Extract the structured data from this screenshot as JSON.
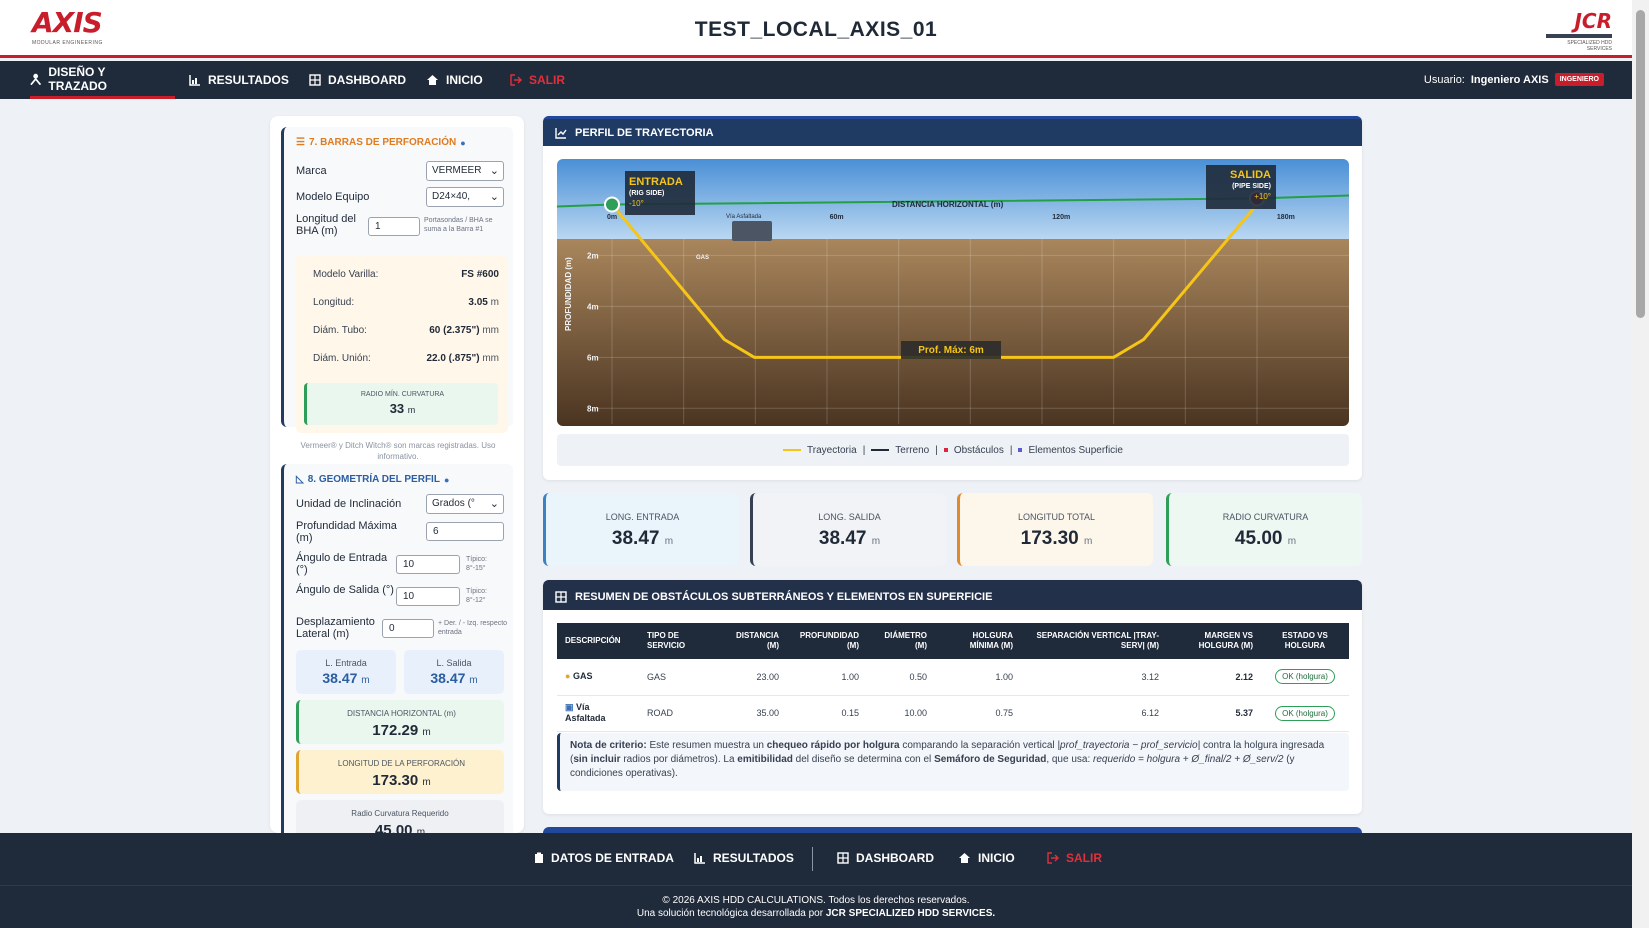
{
  "header": {
    "title": "TEST_LOCAL_AXIS_01",
    "logo_left": "AXIS",
    "logo_left_sub": "MODULAR ENGINEERING",
    "logo_right": "JCR",
    "logo_right_sub": "SPECIALIZED HDD SERVICES"
  },
  "nav": {
    "items": [
      {
        "label": "DISEÑO Y TRAZADO",
        "icon": "user-compass-icon"
      },
      {
        "label": "RESULTADOS",
        "icon": "chart-icon"
      },
      {
        "label": "DASHBOARD",
        "icon": "grid-icon"
      },
      {
        "label": "INICIO",
        "icon": "home-icon"
      },
      {
        "label": "SALIR",
        "icon": "logout-icon"
      }
    ],
    "user_label": "Usuario:",
    "user_name": "Ingeniero AXIS",
    "user_role": "INGENIERO"
  },
  "barras": {
    "title": "7. BARRAS DE PERFORACIÓN",
    "marca_label": "Marca",
    "marca_value": "VERMEER",
    "modelo_label": "Modelo Equipo",
    "modelo_value": "D24×40,",
    "bha_label": "Longitud del BHA (m)",
    "bha_value": "1",
    "bha_hint": "Portasondas / BHA se suma a la Barra #1",
    "varilla_label": "Modelo Varilla:",
    "varilla_value": "FS #600",
    "longitud_label": "Longitud:",
    "longitud_value": "3.05",
    "longitud_unit": "m",
    "tubo_label": "Diám. Tubo:",
    "tubo_value": "60 (2.375\")",
    "tubo_unit": "mm",
    "union_label": "Diám. Unión:",
    "union_value": "22.0 (.875\")",
    "union_unit": "mm",
    "radio_label": "RADIO MÍN. CURVATURA",
    "radio_value": "33",
    "radio_unit": "m",
    "disclaimer": "Vermeer® y Ditch Witch® son marcas registradas. Uso informativo."
  },
  "geometria": {
    "title": "8. GEOMETRÍA DEL PERFIL",
    "unidad_label": "Unidad de Inclinación",
    "unidad_value": "Grados (°",
    "prof_label": "Profundidad Máxima (m)",
    "prof_value": "6",
    "ang_entrada_label": "Ángulo de Entrada (°)",
    "ang_entrada_value": "10",
    "ang_entrada_hint": "Típico: 8°-15°",
    "ang_salida_label": "Ángulo de Salida (°)",
    "ang_salida_value": "10",
    "ang_salida_hint": "Típico: 8°-12°",
    "desp_label": "Desplazamiento Lateral (m)",
    "desp_value": "0",
    "desp_hint": "+ Der. / - Izq. respecto entrada",
    "l_entrada_label": "L. Entrada",
    "l_entrada_value": "38.47",
    "l_salida_label": "L. Salida",
    "l_salida_value": "38.47",
    "unit_m": "m",
    "dist_h_label": "DISTANCIA HORIZONTAL (m)",
    "dist_h_value": "172.29",
    "long_perf_label": "LONGITUD DE LA PERFORACIÓN",
    "long_perf_value": "173.30",
    "radio_req_label": "Radio Curvatura Requerido",
    "radio_req_value": "45.00"
  },
  "perfil": {
    "title": "PERFIL DE TRAYECTORIA",
    "entrada_title": "ENTRADA",
    "entrada_sub": "(RIG SIDE)",
    "entrada_angle": "-10°",
    "salida_title": "SALIDA",
    "salida_sub": "(PIPE SIDE)",
    "salida_angle": "+10°",
    "x_axis_title": "DISTANCIA HORIZONTAL (m)",
    "y_axis_title": "PROFUNDIDAD (m)",
    "prof_max_label": "Prof. Máx: 6m",
    "obstacle_gas": "GAS",
    "surface_via": "Vía Asfaltada",
    "legend": {
      "trayectoria": "Trayectoria",
      "terreno": "Terreno",
      "obstaculos": "Obstáculos",
      "elementos": "Elementos Superficie"
    }
  },
  "chart_data": {
    "type": "line",
    "title": "PERFIL DE TRAYECTORIA",
    "xlabel": "DISTANCIA HORIZONTAL (m)",
    "ylabel": "PROFUNDIDAD (m)",
    "x_ticks": [
      "0m",
      "60m",
      "120m",
      "180m"
    ],
    "y_ticks": [
      "2m",
      "4m",
      "6m",
      "8m"
    ],
    "xlim": [
      0,
      172.29
    ],
    "ylim": [
      8.5,
      -1
    ],
    "series": [
      {
        "name": "Trayectoria",
        "color": "#f5c518",
        "x": [
          0,
          30,
          38,
          134,
          142,
          172.29
        ],
        "y": [
          0,
          5.3,
          6,
          6,
          5.3,
          0
        ]
      },
      {
        "name": "Terreno",
        "color": "#22a045",
        "x": [
          0,
          172.29
        ],
        "y": [
          0,
          0
        ]
      }
    ],
    "points": [
      {
        "name": "Entrada",
        "x": 0,
        "y": 0,
        "color": "#2f9e58"
      },
      {
        "name": "Salida",
        "x": 172.29,
        "y": 0,
        "color": "#d7263d"
      }
    ],
    "obstacles": [
      {
        "name": "GAS",
        "x": 23,
        "y": 1
      }
    ],
    "surface_elements": [
      {
        "name": "Vía Asfaltada",
        "x": 35,
        "y": 0.15
      }
    ],
    "grid": true,
    "legend": "bottom"
  },
  "kpis": [
    {
      "label": "LONG. ENTRADA",
      "value": "38.47",
      "unit": "m",
      "accent": "#3b82c4",
      "bg": "#eaf4fb"
    },
    {
      "label": "LONG. SALIDA",
      "value": "38.47",
      "unit": "m",
      "accent": "#374151",
      "bg": "#f1f3f6"
    },
    {
      "label": "LONGITUD TOTAL",
      "value": "173.30",
      "unit": "m",
      "accent": "#e08a2e",
      "bg": "#fdf6ea"
    },
    {
      "label": "RADIO CURVATURA",
      "value": "45.00",
      "unit": "m",
      "accent": "#2f9e58",
      "bg": "#ecf8f1"
    }
  ],
  "obstaculos": {
    "title": "RESUMEN DE OBSTÁCULOS SUBTERRÁNEOS Y ELEMENTOS EN SUPERFICIE",
    "headers": [
      "DESCRIPCIÓN",
      "TIPO DE SERVICIO",
      "DISTANCIA (M)",
      "PROFUNDIDAD (M)",
      "DIÁMETRO (M)",
      "HOLGURA MÍNIMA (M)",
      "SEPARACIÓN VERTICAL |TRAY-SERV| (M)",
      "MARGEN VS HOLGURA (M)",
      "ESTADO VS HOLGURA"
    ],
    "rows": [
      {
        "desc": "GAS",
        "tipo": "GAS",
        "dist": "23.00",
        "prof": "1.00",
        "diam": "0.50",
        "holg": "1.00",
        "sep": "3.12",
        "margen": "2.12",
        "estado": "OK (holgura)"
      },
      {
        "desc": "Vía Asfaltada",
        "tipo": "ROAD",
        "dist": "35.00",
        "prof": "0.15",
        "diam": "10.00",
        "holg": "0.75",
        "sep": "6.12",
        "margen": "5.37",
        "estado": "OK (holgura)"
      }
    ],
    "nota": {
      "t1": "Nota de criterio:",
      "t2": " Este resumen muestra un ",
      "t3": "chequeo rápido por holgura",
      "t4": " comparando la separación vertical ",
      "t5": "|prof_trayectoria − prof_servicio|",
      "t6": " contra la holgura ingresada (",
      "t7": "sin incluir",
      "t8": " radios por diámetros). La ",
      "t9": "emitibilidad",
      "t10": " del diseño se determina con el ",
      "t11": "Semáforo de Seguridad",
      "t12": ", que usa: ",
      "t13": "requerido = holgura + Ø_final/2 + Ø_serv/2",
      "t14": " (y condiciones operativas)."
    }
  },
  "footer": {
    "nav": [
      {
        "label": "DATOS DE ENTRADA",
        "icon": "clipboard-icon"
      },
      {
        "label": "RESULTADOS",
        "icon": "chart-icon"
      },
      {
        "label": "DASHBOARD",
        "icon": "grid-icon"
      },
      {
        "label": "INICIO",
        "icon": "home-icon"
      },
      {
        "label": "SALIR",
        "icon": "logout-icon"
      }
    ],
    "copyright": "© 2026 AXIS HDD CALCULATIONS. Todos los derechos reservados.",
    "credit_prefix": "Una solución tecnológica desarrollada por ",
    "credit_company": "JCR SPECIALIZED HDD SERVICES."
  }
}
